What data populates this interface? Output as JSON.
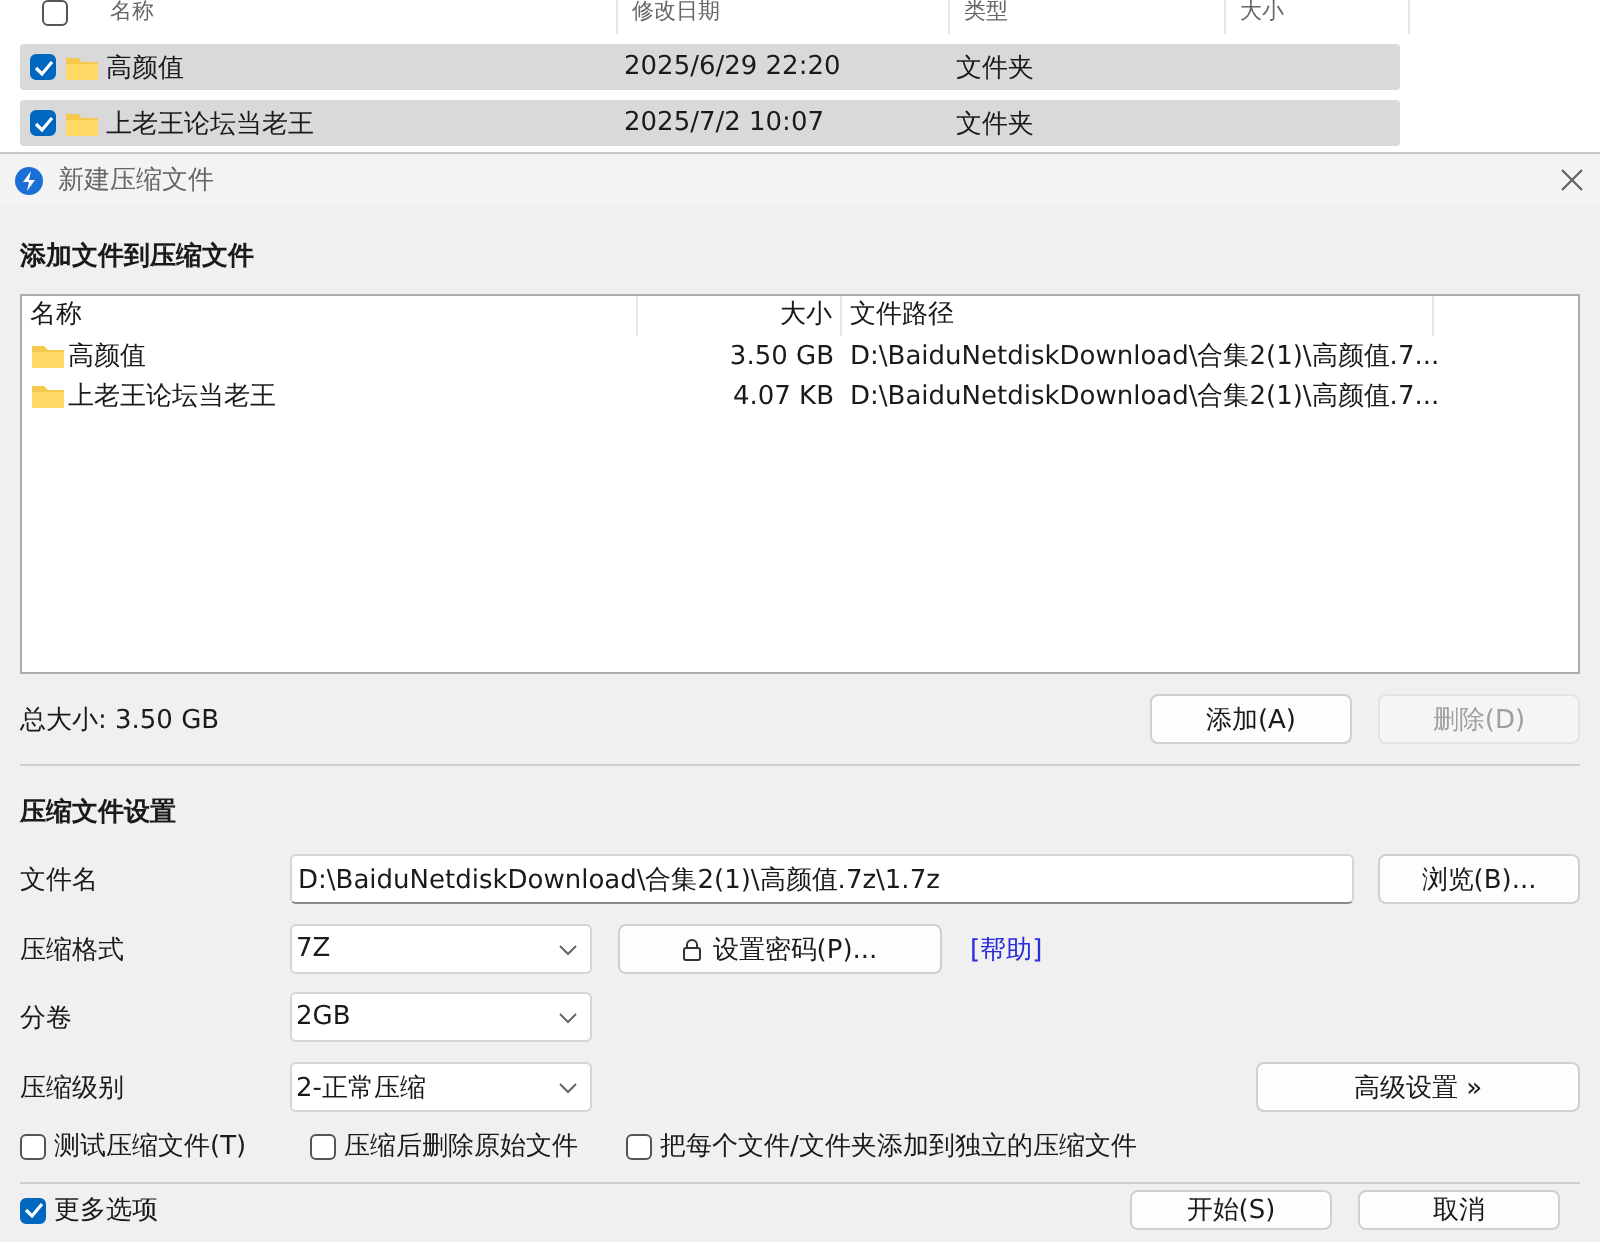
{
  "explorer": {
    "header_checked": false,
    "columns": [
      "名称",
      "修改日期",
      "类型",
      "大小"
    ],
    "rows": [
      {
        "name": "高颜值",
        "modified": "2025/6/29 22:20",
        "type": "文件夹",
        "checked": true,
        "selected": true
      },
      {
        "name": "上老王论坛当老王",
        "modified": "2025/7/2 10:07",
        "type": "文件夹",
        "checked": true,
        "selected": true
      }
    ]
  },
  "dialog": {
    "title": "新建压缩文件",
    "files_heading": "添加文件到压缩文件",
    "file_list": {
      "columns": [
        "名称",
        "大小",
        "文件路径"
      ],
      "rows": [
        {
          "name": "高颜值",
          "size": "3.50 GB",
          "path": "D:\\BaiduNetdiskDownload\\合集2(1)\\高颜值.7..."
        },
        {
          "name": "上老王论坛当老王",
          "size": "4.07 KB",
          "path": "D:\\BaiduNetdiskDownload\\合集2(1)\\高颜值.7..."
        }
      ]
    },
    "total_size": "总大小: 3.50 GB",
    "list_buttons": [
      {
        "label": "添加(A)",
        "disabled": false
      },
      {
        "label": "删除(D)",
        "disabled": true
      }
    ],
    "settings_heading": "压缩文件设置",
    "filename": {
      "label": "文件名",
      "value": "D:\\BaiduNetdiskDownload\\合集2(1)\\高颜值.7z\\1.7z"
    },
    "browse_button": "浏览(B)...",
    "format": {
      "label": "压缩格式",
      "value": "7Z"
    },
    "password_button": "设置密码(P)...",
    "help_link": "[帮助]",
    "volume": {
      "label": "分卷",
      "value": "2GB"
    },
    "level": {
      "label": "压缩级别",
      "value": "2-正常压缩"
    },
    "advanced_button": "高级设置 »",
    "options": [
      {
        "label": "测试压缩文件(T)",
        "checked": false
      },
      {
        "label": "压缩后删除原始文件",
        "checked": false
      },
      {
        "label": "把每个文件/文件夹添加到独立的压缩文件",
        "checked": false
      }
    ],
    "more_options": {
      "label": "更多选项",
      "checked": true
    },
    "buttons": [
      "开始(S)",
      "取消"
    ]
  }
}
